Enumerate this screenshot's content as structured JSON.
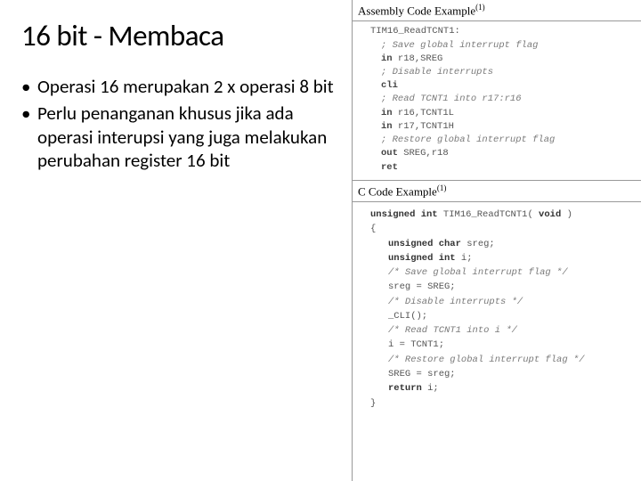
{
  "slide": {
    "title": "16 bit - Membaca",
    "bullets": [
      "Operasi 16 merupakan 2 x operasi 8 bit",
      "Perlu penanganan khusus jika ada operasi interupsi yang juga melakukan perubahan register 16 bit"
    ]
  },
  "asm": {
    "header": "Assembly Code Example",
    "sup": "(1)",
    "label": "TIM16_ReadTCNT1:",
    "lines": [
      {
        "t": "; Save global interrupt flag",
        "cls": "comment-line"
      },
      {
        "b": "in",
        "r": " r18,SREG"
      },
      {
        "t": "; Disable interrupts",
        "cls": "comment-line"
      },
      {
        "b": "cli",
        "r": ""
      },
      {
        "t": "; Read TCNT1 into r17:r16",
        "cls": "comment-line"
      },
      {
        "b": "in",
        "r": " r16,TCNT1L"
      },
      {
        "b": "in",
        "r": " r17,TCNT1H"
      },
      {
        "t": "; Restore global interrupt flag",
        "cls": "comment-line"
      },
      {
        "b": "out",
        "r": " SREG,r18"
      },
      {
        "b": "ret",
        "r": ""
      }
    ]
  },
  "c": {
    "header": "C Code Example",
    "sup": "(1)",
    "sig_pre": "unsigned int",
    "sig_name": " TIM16_ReadTCNT1( ",
    "sig_arg": "void",
    "sig_post": " )",
    "open": "{",
    "close": "}",
    "decl1_kw": "unsigned char",
    "decl1_rest": " sreg;",
    "decl2_kw": "unsigned int",
    "decl2_rest": " i;",
    "cm1": "/* Save global interrupt flag */",
    "l1": "sreg = SREG;",
    "cm2": "/* Disable interrupts */",
    "l2": "_CLI();",
    "cm3": "/* Read TCNT1 into i */",
    "l3": "i = TCNT1;",
    "cm4": "/* Restore global interrupt flag */",
    "l4": "SREG = sreg;",
    "ret_kw": "return",
    "ret_rest": " i;"
  }
}
